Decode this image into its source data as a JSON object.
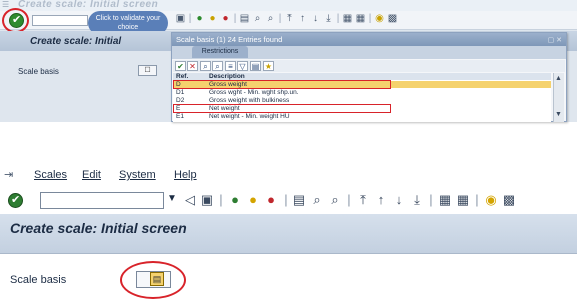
{
  "top": {
    "window_title": "Create scale: Initial screen",
    "tooltip": "Click to validate your choice",
    "header_title": "Create scale: Initial",
    "scale_basis_label": "Scale basis",
    "popup": {
      "title": "Scale basis (1)   24 Entries found",
      "tab": "Restrictions",
      "columns": [
        "Ref.",
        "Description"
      ],
      "rows": [
        {
          "ref": "D",
          "desc": "Gross weight",
          "selected": true
        },
        {
          "ref": "D1",
          "desc": "Gross wght - Min. wght shp.un.",
          "selected": false
        },
        {
          "ref": "D2",
          "desc": "Gross weight with bulkiness",
          "selected": false
        },
        {
          "ref": "E",
          "desc": "Net weight",
          "selected": false
        },
        {
          "ref": "E1",
          "desc": "Net weight - Min. weight HU",
          "selected": false
        }
      ]
    }
  },
  "bottom": {
    "menu": {
      "scales": "Scales",
      "edit": "Edit",
      "system": "System",
      "help": "Help"
    },
    "header_title": "Create scale: Initial screen",
    "scale_basis_label": "Scale basis"
  },
  "colors": {
    "highlight_red": "#d8232a",
    "selected_row": "#f5d26e",
    "check_green": "#2e7d32"
  }
}
